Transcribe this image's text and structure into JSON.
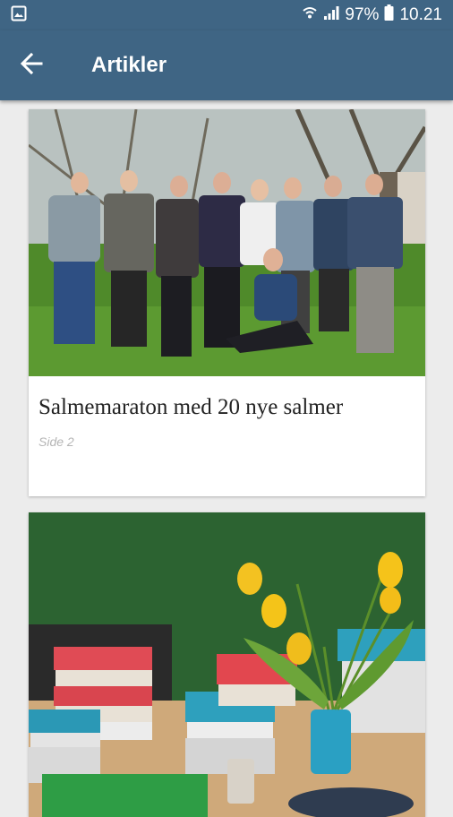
{
  "status_bar": {
    "battery_percent": "97%",
    "time": "10.21",
    "icons": [
      "image-notification-icon",
      "wifi-icon",
      "signal-icon",
      "battery-icon"
    ]
  },
  "app_bar": {
    "title": "Artikler",
    "back_icon": "arrow-back-icon"
  },
  "articles": [
    {
      "title": "Salmemaraton med 20 nye salmer",
      "page": "Side 2",
      "image": "group-photo-in-garden"
    },
    {
      "title": "",
      "page": "",
      "image": "books-and-yellow-tulips"
    }
  ],
  "colors": {
    "primary": "#3f6584",
    "background": "#ececec",
    "page_label": "#b5b5b5"
  }
}
